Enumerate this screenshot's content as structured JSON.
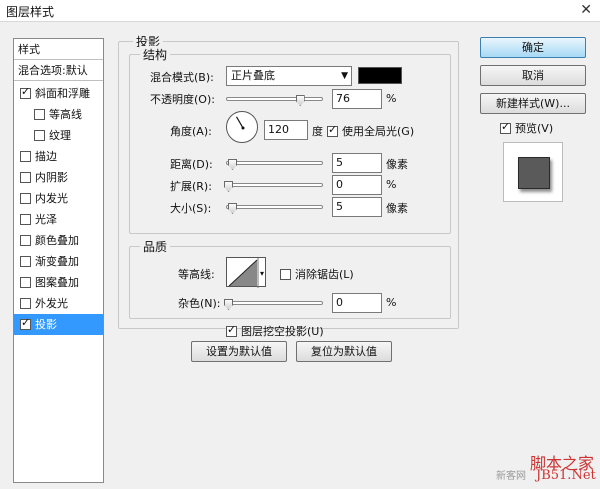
{
  "window": {
    "title": "图层样式"
  },
  "style_list": {
    "header": "样式",
    "blend_options": "混合选项:默认",
    "items": [
      {
        "label": "斜面和浮雕",
        "checked": true,
        "indent": false
      },
      {
        "label": "等高线",
        "checked": false,
        "indent": true
      },
      {
        "label": "纹理",
        "checked": false,
        "indent": true
      },
      {
        "label": "描边",
        "checked": false,
        "indent": false
      },
      {
        "label": "内阴影",
        "checked": false,
        "indent": false
      },
      {
        "label": "内发光",
        "checked": false,
        "indent": false
      },
      {
        "label": "光泽",
        "checked": false,
        "indent": false
      },
      {
        "label": "颜色叠加",
        "checked": false,
        "indent": false
      },
      {
        "label": "渐变叠加",
        "checked": false,
        "indent": false
      },
      {
        "label": "图案叠加",
        "checked": false,
        "indent": false
      },
      {
        "label": "外发光",
        "checked": false,
        "indent": false
      },
      {
        "label": "投影",
        "checked": true,
        "indent": false,
        "selected": true
      }
    ]
  },
  "drop_shadow": {
    "title": "投影",
    "structure": {
      "title": "结构",
      "blend_mode_label": "混合模式(B):",
      "blend_mode_value": "正片叠底",
      "shadow_color": "#000000",
      "opacity_label": "不透明度(O):",
      "opacity_value": "76",
      "opacity_unit": "%",
      "opacity_fraction": 0.76,
      "angle_label": "角度(A):",
      "angle_value": "120",
      "angle_unit": "度",
      "angle_degrees": 120,
      "global_light_label": "使用全局光(G)",
      "global_light_checked": true,
      "distance_label": "距离(D):",
      "distance_value": "5",
      "distance_unit": "像素",
      "spread_label": "扩展(R):",
      "spread_value": "0",
      "spread_unit": "%",
      "size_label": "大小(S):",
      "size_value": "5",
      "size_unit": "像素"
    },
    "quality": {
      "title": "品质",
      "contour_label": "等高线:",
      "anti_alias_label": "消除锯齿(L)",
      "anti_alias_checked": false,
      "noise_label": "杂色(N):",
      "noise_value": "0",
      "noise_unit": "%"
    },
    "knockout_label": "图层挖空投影(U)",
    "knockout_checked": true,
    "set_default_label": "设置为默认值",
    "reset_default_label": "复位为默认值"
  },
  "buttons": {
    "ok": "确定",
    "cancel": "取消",
    "new_style": "新建样式(W)..."
  },
  "preview": {
    "label": "预览(V)",
    "checked": true
  },
  "watermarks": {
    "site_left": "新客网",
    "brand_cn": "脚本之家",
    "brand_en": "JB51.Net"
  }
}
